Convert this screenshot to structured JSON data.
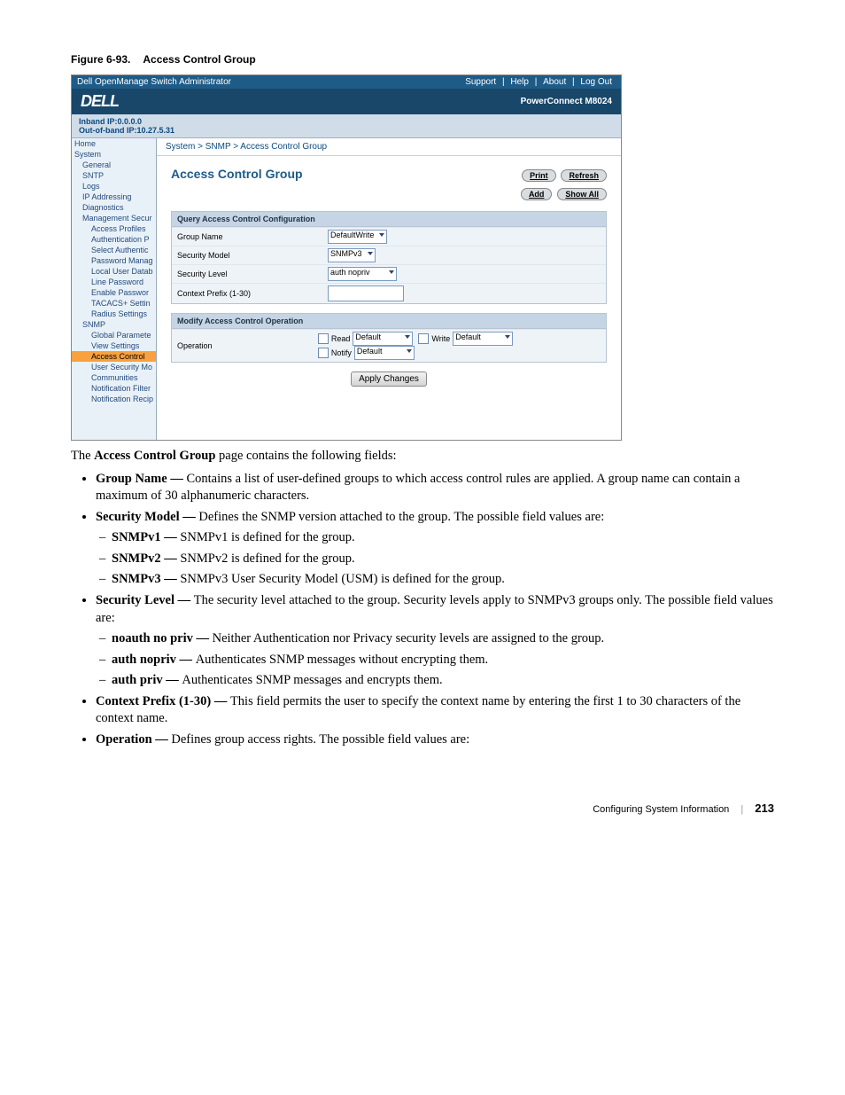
{
  "figure": {
    "label": "Figure 6-93.",
    "title": "Access Control Group"
  },
  "screenshot": {
    "topbar": {
      "title": "Dell OpenManage Switch Administrator",
      "links": [
        "Support",
        "Help",
        "About",
        "Log Out"
      ]
    },
    "branding": {
      "logo": "DELL",
      "model": "PowerConnect M8024"
    },
    "ipbar": {
      "l1": "Inband IP:0.0.0.0",
      "l2": "Out-of-band IP:10.27.5.31"
    },
    "tree": [
      {
        "lvl": 1,
        "label": "Home"
      },
      {
        "lvl": 1,
        "label": "System"
      },
      {
        "lvl": 2,
        "label": "General"
      },
      {
        "lvl": 2,
        "label": "SNTP"
      },
      {
        "lvl": 2,
        "label": "Logs"
      },
      {
        "lvl": 2,
        "label": "IP Addressing"
      },
      {
        "lvl": 2,
        "label": "Diagnostics"
      },
      {
        "lvl": 2,
        "label": "Management Secur"
      },
      {
        "lvl": 3,
        "label": "Access Profiles"
      },
      {
        "lvl": 3,
        "label": "Authentication P"
      },
      {
        "lvl": 3,
        "label": "Select Authentic"
      },
      {
        "lvl": 3,
        "label": "Password Manag"
      },
      {
        "lvl": 3,
        "label": "Local User Datab"
      },
      {
        "lvl": 3,
        "label": "Line Password"
      },
      {
        "lvl": 3,
        "label": "Enable Passwor"
      },
      {
        "lvl": 3,
        "label": "TACACS+ Settin"
      },
      {
        "lvl": 3,
        "label": "Radius Settings"
      },
      {
        "lvl": 2,
        "label": "SNMP"
      },
      {
        "lvl": 3,
        "label": "Global Paramete"
      },
      {
        "lvl": 3,
        "label": "View Settings"
      },
      {
        "lvl": 3,
        "label": "Access Control",
        "sel": true
      },
      {
        "lvl": 3,
        "label": "User Security Mo"
      },
      {
        "lvl": 3,
        "label": "Communities"
      },
      {
        "lvl": 3,
        "label": "Notification Filter"
      },
      {
        "lvl": 3,
        "label": "Notification Recip"
      }
    ],
    "breadcrumb": "System > SNMP > Access Control Group",
    "page_title": "Access Control Group",
    "buttons": {
      "print": "Print",
      "refresh": "Refresh",
      "add": "Add",
      "showall": "Show All"
    },
    "panel1": {
      "header": "Query Access Control Configuration",
      "rows": {
        "group_name": {
          "lbl": "Group Name",
          "val": "DefaultWrite"
        },
        "security_model": {
          "lbl": "Security Model",
          "val": "SNMPv3"
        },
        "security_level": {
          "lbl": "Security Level",
          "val": "auth nopriv"
        },
        "context_prefix": {
          "lbl": "Context Prefix (1-30)",
          "val": ""
        }
      }
    },
    "panel2": {
      "header": "Modify Access Control Operation",
      "op_label": "Operation",
      "ops": [
        {
          "name": "Read",
          "val": "Default"
        },
        {
          "name": "Write",
          "val": "Default"
        },
        {
          "name": "Notify",
          "val": "Default"
        }
      ]
    },
    "apply_btn": "Apply Changes"
  },
  "body": {
    "intro_a": "The ",
    "intro_b": "Access Control Group",
    "intro_c": " page contains the following fields:",
    "items": [
      {
        "term": "Group Name — ",
        "desc": "Contains a list of user-defined groups to which access control rules are applied. A group name can contain a maximum of 30 alphanumeric characters."
      },
      {
        "term": "Security Model — ",
        "desc": "Defines the SNMP version attached to the group. The possible field values are:",
        "sub": [
          {
            "term": "SNMPv1 — ",
            "desc": "SNMPv1 is defined for the group."
          },
          {
            "term": "SNMPv2 — ",
            "desc": "SNMPv2 is defined for the group."
          },
          {
            "term": "SNMPv3 — ",
            "desc": "SNMPv3 User Security Model (USM) is defined for the group."
          }
        ]
      },
      {
        "term": "Security Level — ",
        "desc": "The security level attached to the group. Security levels apply to SNMPv3 groups only. The possible field values are:",
        "sub": [
          {
            "term": "noauth no priv — ",
            "desc": "Neither Authentication nor Privacy security levels are assigned to the group."
          },
          {
            "term": "auth nopriv — ",
            "desc": "Authenticates SNMP messages without encrypting them."
          },
          {
            "term": "auth priv — ",
            "desc": "Authenticates SNMP messages and encrypts them."
          }
        ]
      },
      {
        "term": "Context Prefix (1-30) — ",
        "desc": "This field permits the user to specify the context name by entering the first 1 to 30 characters of the context name."
      },
      {
        "term": "Operation — ",
        "desc": "Defines group access rights. The possible field values are:"
      }
    ]
  },
  "footer": {
    "section": "Configuring System Information",
    "page": "213"
  }
}
